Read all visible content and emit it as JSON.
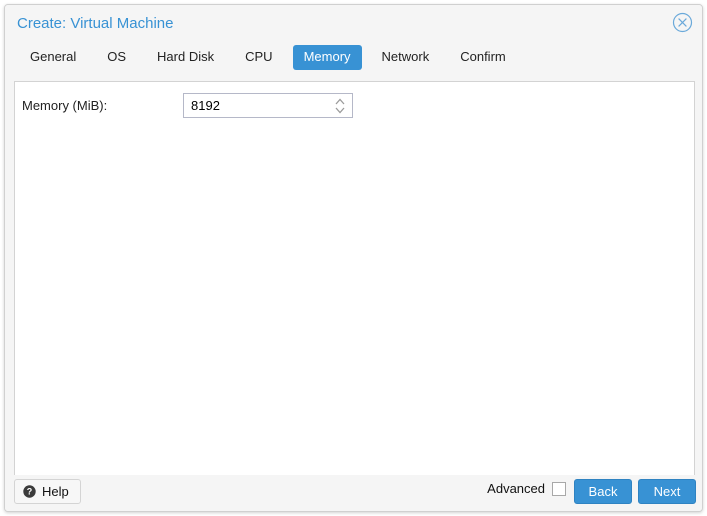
{
  "window": {
    "title": "Create: Virtual Machine",
    "close_icon": "close-circle-icon",
    "accent_color": "#3892d4",
    "titlebar_bg": "#f5f5f5",
    "content_bg": "#ffffff"
  },
  "tabs": [
    {
      "label": "General",
      "active": false
    },
    {
      "label": "OS",
      "active": false
    },
    {
      "label": "Hard Disk",
      "active": false
    },
    {
      "label": "CPU",
      "active": false
    },
    {
      "label": "Memory",
      "active": true
    },
    {
      "label": "Network",
      "active": false
    },
    {
      "label": "Confirm",
      "active": false
    }
  ],
  "form": {
    "memory": {
      "label": "Memory (MiB):",
      "value": "8192",
      "spinner_icon": "spinner-updown-icon"
    }
  },
  "footer": {
    "help": {
      "label": "Help",
      "icon": "question-mark-circle-icon"
    },
    "advanced": {
      "label": "Advanced",
      "checked": false
    },
    "back_label": "Back",
    "next_label": "Next"
  }
}
